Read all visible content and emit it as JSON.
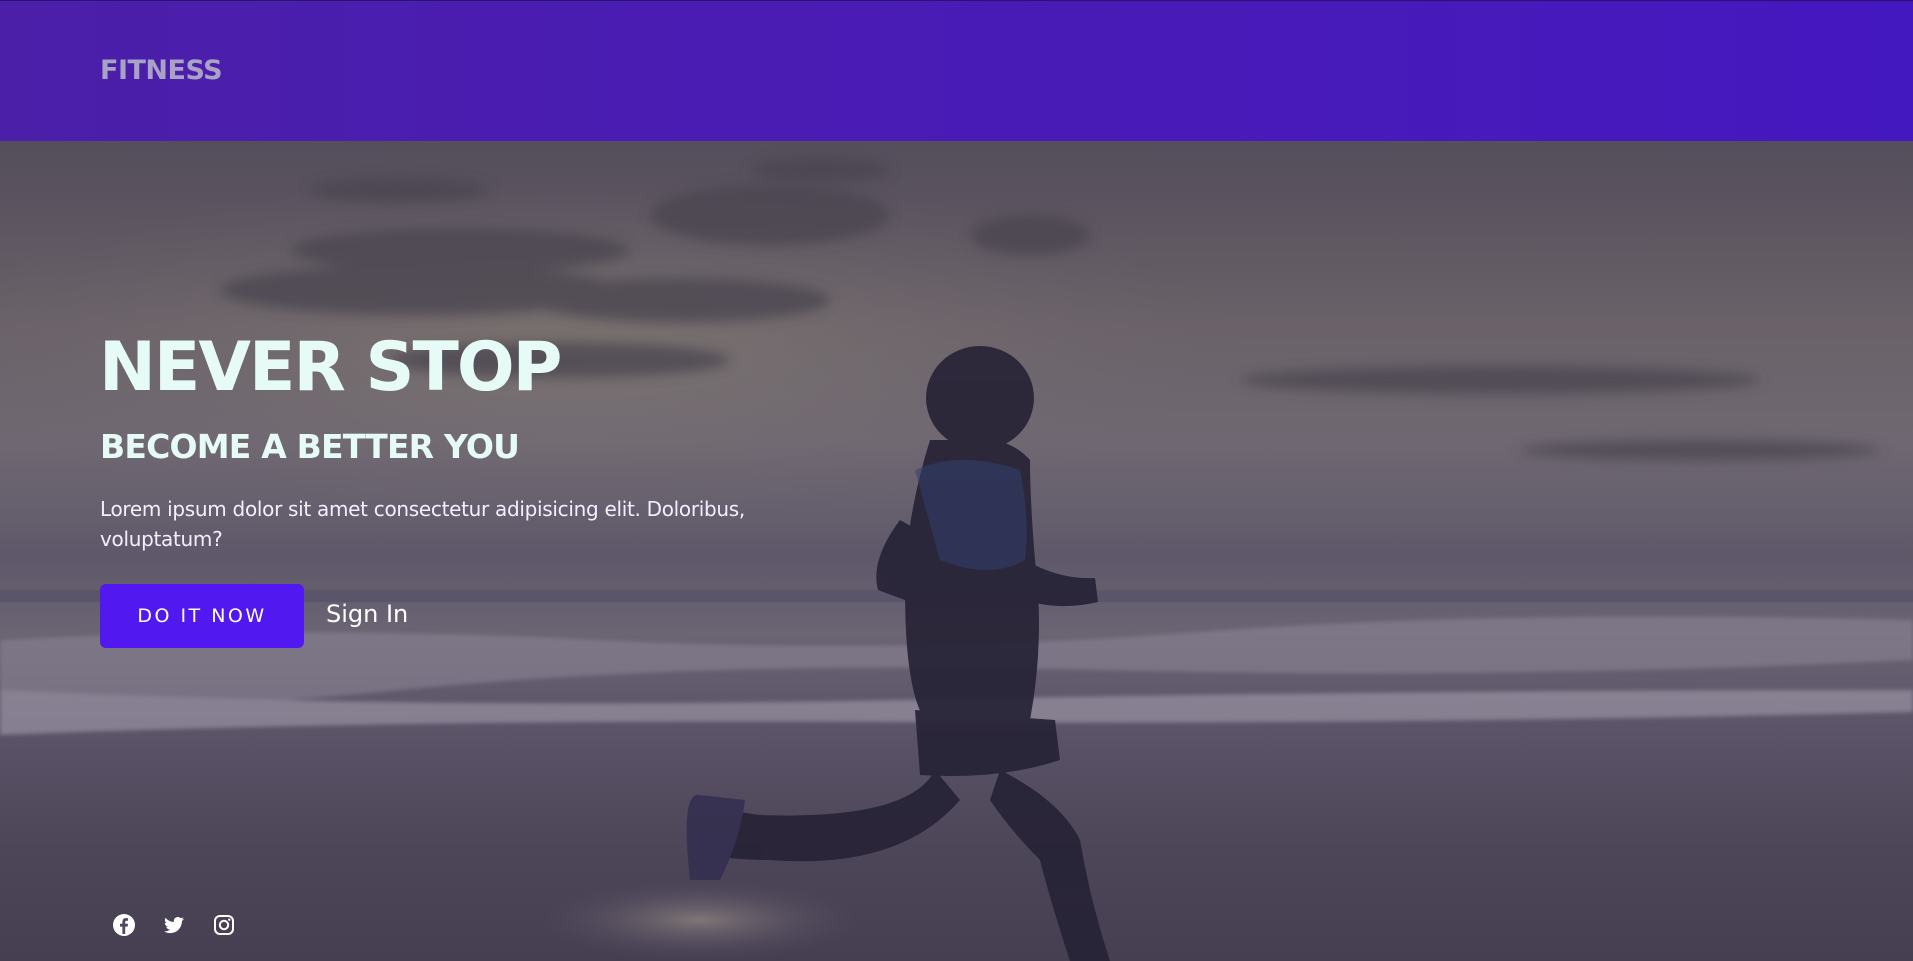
{
  "header": {
    "logo": "FITNESS"
  },
  "hero": {
    "title": "NEVER STOP",
    "subtitle": "BECOME A BETTER YOU",
    "text": "Lorem ipsum dolor sit amet consectetur adipisicing elit. Doloribus, voluptatum?",
    "cta_label": "DO IT NOW",
    "signin_label": "Sign In"
  },
  "social": {
    "icons": [
      "facebook-icon",
      "twitter-icon",
      "instagram-icon"
    ]
  },
  "colors": {
    "header_bg": "#4a1cb4",
    "accent": "#5218f0",
    "heading": "#e6fbf5",
    "logo": "#a8a2c4"
  }
}
